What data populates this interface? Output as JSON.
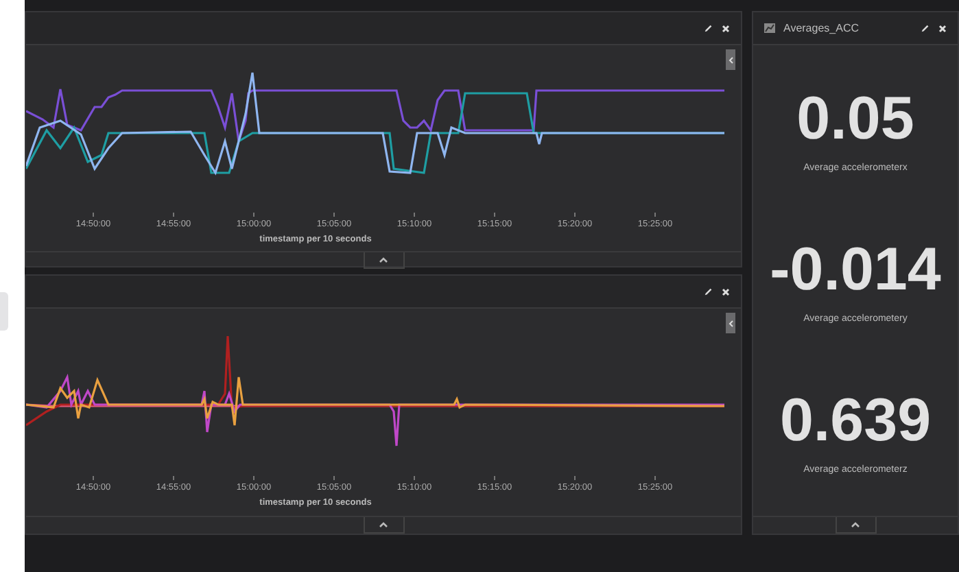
{
  "panels": [
    {
      "kind": "chart",
      "xticks": [
        "14:50:00",
        "14:55:00",
        "15:00:00",
        "15:05:00",
        "15:10:00",
        "15:15:00",
        "15:20:00",
        "15:25:00"
      ],
      "xlabel": "timestamp per 10 seconds"
    },
    {
      "kind": "chart",
      "xticks": [
        "14:50:00",
        "14:55:00",
        "15:00:00",
        "15:05:00",
        "15:10:00",
        "15:15:00",
        "15:20:00",
        "15:25:00"
      ],
      "xlabel": "timestamp per 10 seconds"
    }
  ],
  "stats": {
    "title": "Averages_ACC",
    "metrics": [
      {
        "value": "0.05",
        "label": "Average accelerometerx"
      },
      {
        "value": "-0.014",
        "label": "Average accelerometery"
      },
      {
        "value": "0.639",
        "label": "Average accelerometerz"
      }
    ]
  }
}
